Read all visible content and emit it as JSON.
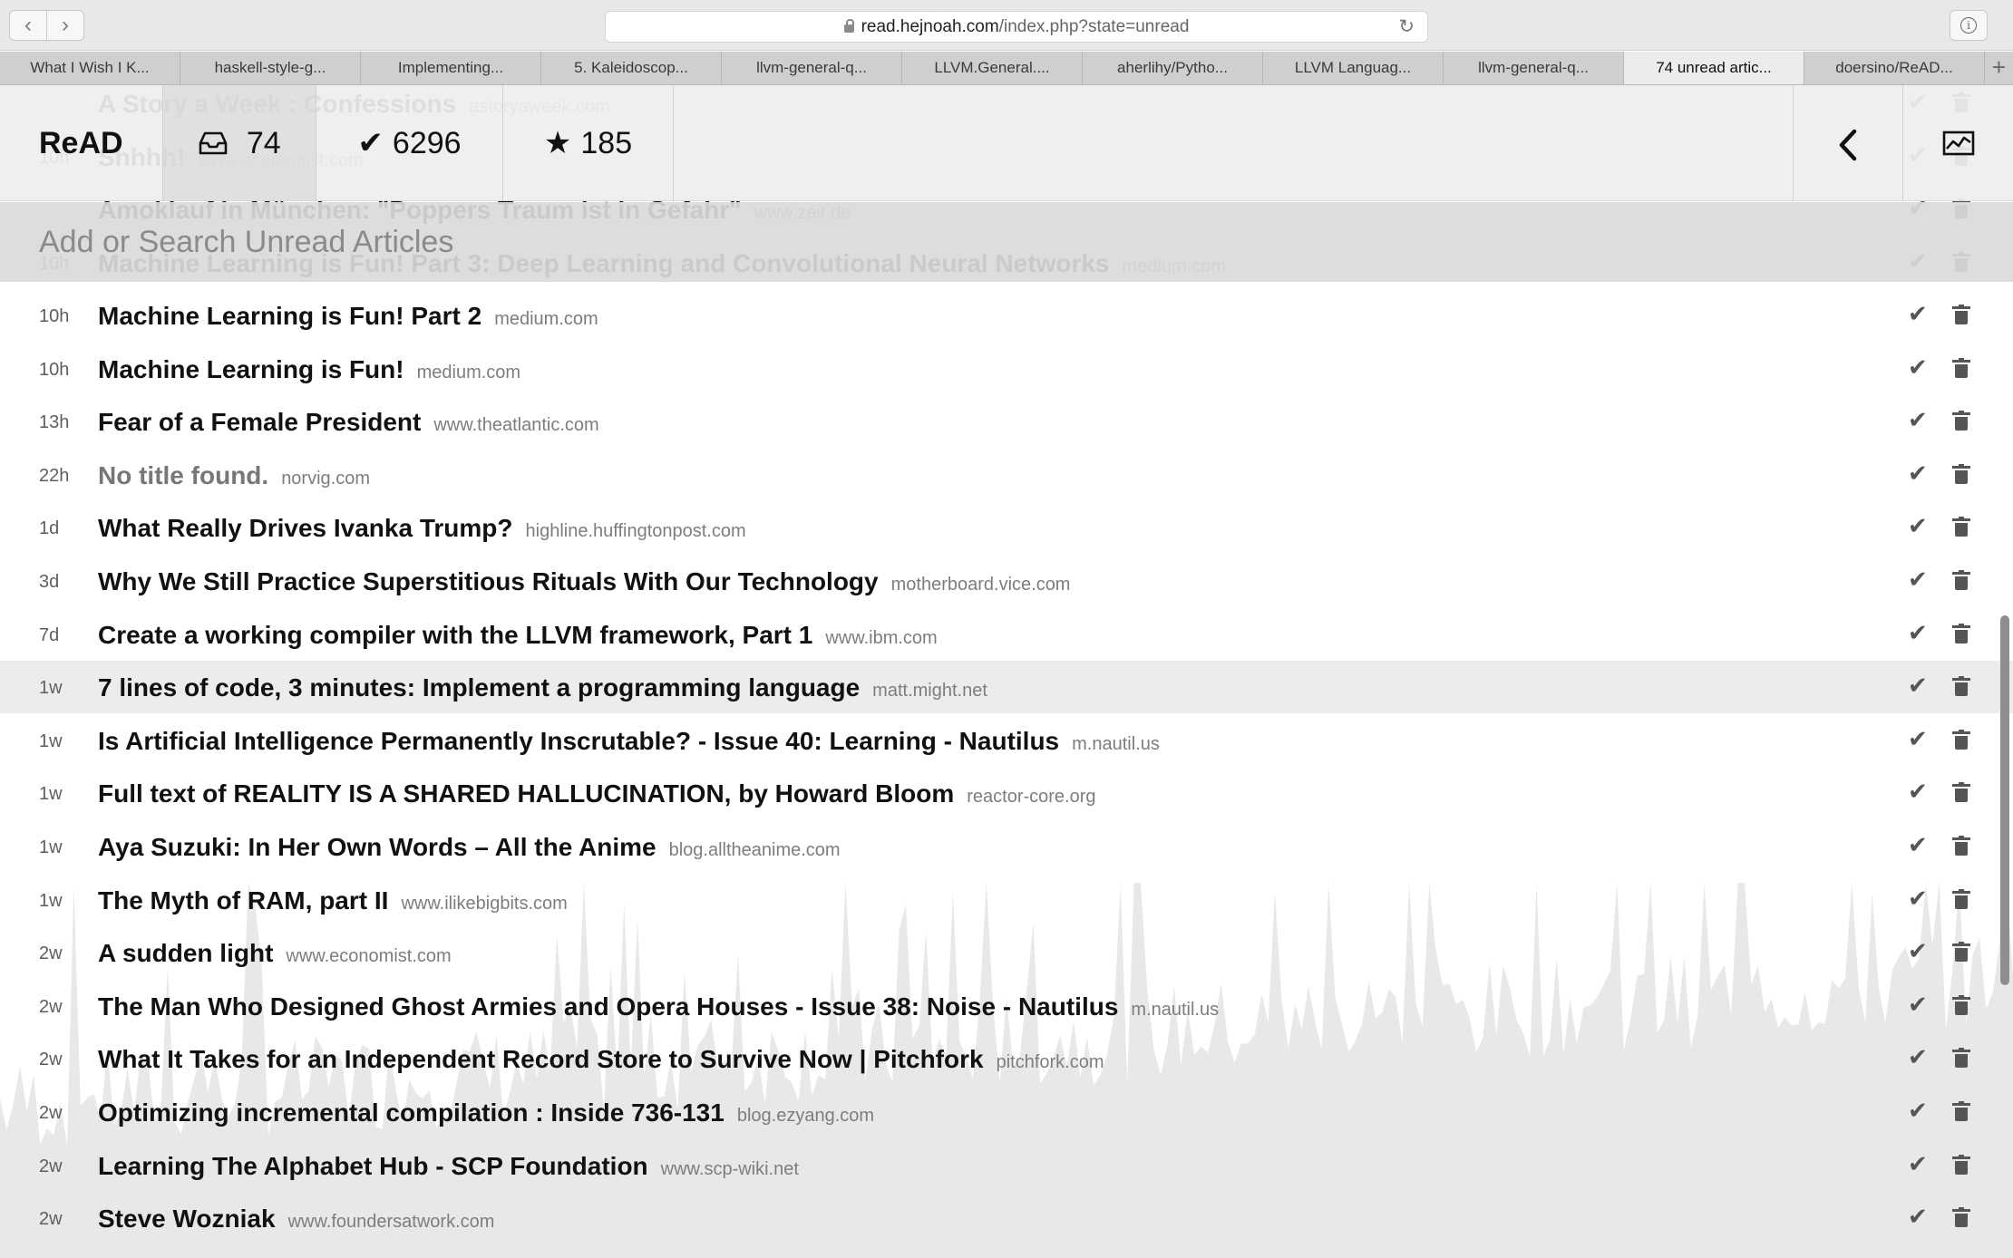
{
  "browser": {
    "address": {
      "host": "read.hejnoah.com",
      "path": "/index.php?state=unread"
    },
    "tabs": [
      {
        "label": "What I Wish I K..."
      },
      {
        "label": "haskell-style-g..."
      },
      {
        "label": "Implementing..."
      },
      {
        "label": "5. Kaleidoscop..."
      },
      {
        "label": "llvm-general-q..."
      },
      {
        "label": "LLVM.General...."
      },
      {
        "label": "aherlihy/Pytho..."
      },
      {
        "label": "LLVM Languag..."
      },
      {
        "label": "llvm-general-q..."
      },
      {
        "label": "74 unread artic...",
        "active": true
      },
      {
        "label": "doersino/ReAD..."
      }
    ],
    "nav_back_icon": "chevron-left-icon",
    "nav_forward_icon": "chevron-right-icon",
    "new_tab_label": "+"
  },
  "header": {
    "brand": "ReAD",
    "unread_count": "74",
    "archived_count": "6296",
    "starred_count": "185",
    "unread_icon": "inbox-icon",
    "archived_icon": "check-icon",
    "starred_icon": "star-icon",
    "back_icon": "chevron-left-icon",
    "stats_icon": "line-chart-icon"
  },
  "search": {
    "placeholder": "Add or Search Unread Articles"
  },
  "partial_rows": [
    {
      "title": "A Story a Week : Confessions",
      "domain": "astoryaweek.com"
    },
    {
      "age": "10h",
      "title": "Shhhh!",
      "domain": "www.economist.com"
    },
    {
      "title": "Amoklauf in München: \"Poppers Traum ist in Gefahr\"",
      "domain": "www.zeit.de"
    },
    {
      "age": "10h",
      "title": "Machine Learning is Fun! Part 3: Deep Learning and Convolutional Neural Networks",
      "domain": "medium.com"
    }
  ],
  "articles": [
    {
      "age": "10h",
      "title": "Machine Learning is Fun! Part 2",
      "domain": "medium.com"
    },
    {
      "age": "10h",
      "title": "Machine Learning is Fun!",
      "domain": "medium.com"
    },
    {
      "age": "13h",
      "title": "Fear of a Female President",
      "domain": "www.theatlantic.com"
    },
    {
      "age": "22h",
      "title": "No title found.",
      "domain": "norvig.com",
      "muted": true
    },
    {
      "age": "1d",
      "title": "What Really Drives Ivanka Trump?",
      "domain": "highline.huffingtonpost.com"
    },
    {
      "age": "3d",
      "title": "Why We Still Practice Superstitious Rituals With Our Technology",
      "domain": "motherboard.vice.com"
    },
    {
      "age": "7d",
      "title": "Create a working compiler with the LLVM framework, Part 1",
      "domain": "www.ibm.com"
    },
    {
      "age": "1w",
      "title": "7 lines of code, 3 minutes: Implement a programming language",
      "domain": "matt.might.net",
      "highlighted": true
    },
    {
      "age": "1w",
      "title": "Is Artificial Intelligence Permanently Inscrutable? - Issue 40: Learning - Nautilus",
      "domain": "m.nautil.us"
    },
    {
      "age": "1w",
      "title": "Full text of REALITY IS A SHARED HALLUCINATION, by Howard Bloom",
      "domain": "reactor-core.org"
    },
    {
      "age": "1w",
      "title": "Aya Suzuki: In Her Own Words – All the Anime",
      "domain": "blog.alltheanime.com"
    },
    {
      "age": "1w",
      "title": "The Myth of RAM, part II",
      "domain": "www.ilikebigbits.com"
    },
    {
      "age": "2w",
      "title": "A sudden light",
      "domain": "www.economist.com"
    },
    {
      "age": "2w",
      "title": "The Man Who Designed Ghost Armies and Opera Houses - Issue 38: Noise - Nautilus",
      "domain": "m.nautil.us"
    },
    {
      "age": "2w",
      "title": "What It Takes for an Independent Record Store to Survive Now | Pitchfork",
      "domain": "pitchfork.com"
    },
    {
      "age": "2w",
      "title": "Optimizing incremental compilation : Inside 736-131",
      "domain": "blog.ezyang.com"
    },
    {
      "age": "2w",
      "title": "Learning The Alphabet Hub - SCP Foundation",
      "domain": "www.scp-wiki.net"
    },
    {
      "age": "2w",
      "title": "Steve Wozniak",
      "domain": "www.foundersatwork.com"
    }
  ],
  "row_icons": {
    "archive": "check-icon",
    "delete": "trash-icon"
  },
  "colors": {
    "header_bg": "#eeeeee",
    "search_bg": "#dadada",
    "highlight_row": "#ededed",
    "graph_fill": "#e8e8e8"
  }
}
